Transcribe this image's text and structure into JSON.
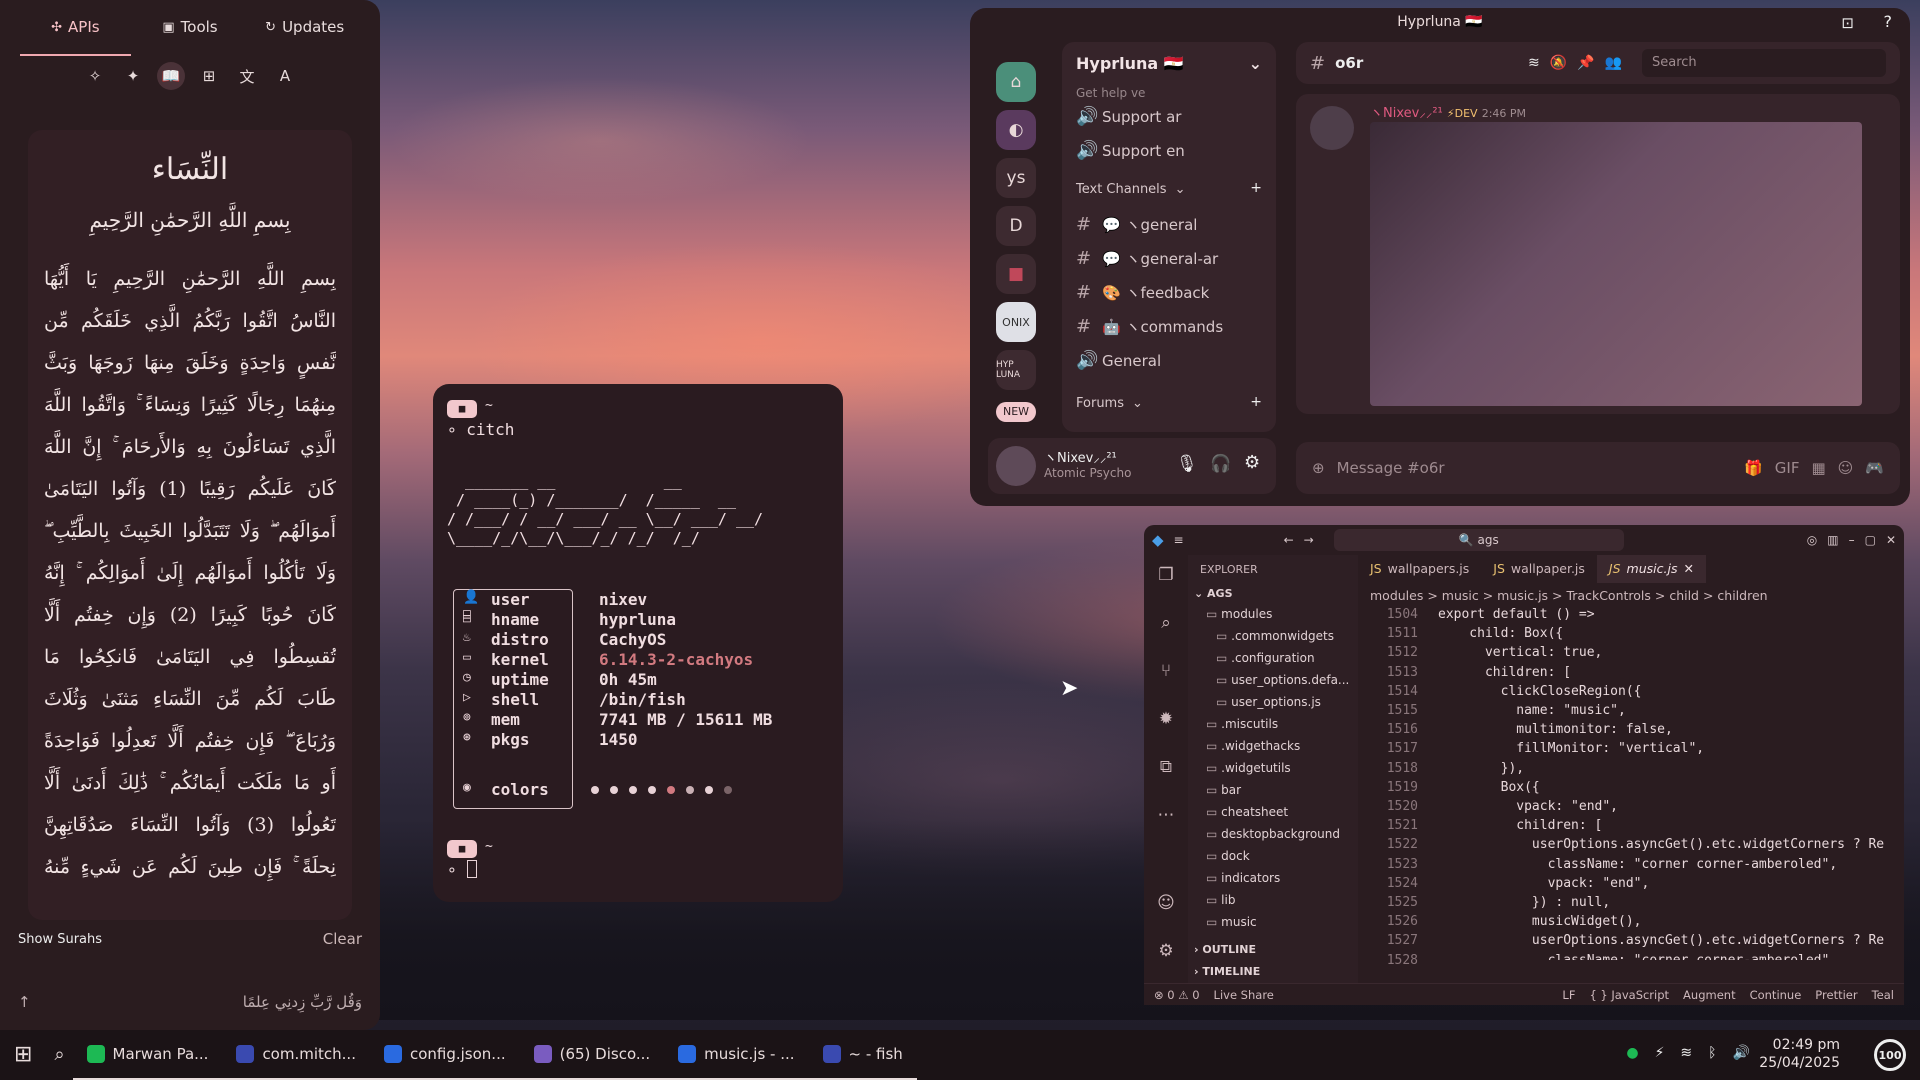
{
  "left_tabs": [
    "APIs",
    "Tools",
    "Updates"
  ],
  "quran": {
    "title": "النِّسَاء",
    "bismillah": "بِسمِ اللَّهِ الرَّحمَٰنِ الرَّحِيمِ",
    "lines": [
      "بِسمِ اللَّهِ الرَّحمَٰنِ الرَّحِيمِ يَا أَيُّهَا",
      "النَّاسُ اتَّقُوا رَبَّكُمُ الَّذِي خَلَقَكُم مِّن",
      "نَّفسٍ وَاحِدَةٍ وَخَلَقَ مِنهَا زَوجَهَا وَبَثَّ",
      "مِنهُمَا رِجَالًا كَثِيرًا وَنِسَاءً ۚ وَاتَّقُوا اللَّهَ",
      "الَّذِي تَسَاءَلُونَ بِهِ وَالأَرحَامَ ۚ إِنَّ اللَّهَ",
      "كَانَ عَلَيكُم رَقِيبًا (1) وَآتُوا اليَتَامَىٰ",
      "أَموَالَهُم ۖ وَلَا تَتَبَدَّلُوا الخَبِيثَ بِالطَّيِّبِ ۖ",
      "وَلَا تَأكُلُوا أَموَالَهُم إِلَىٰ أَموَالِكُم ۚ إِنَّهُ",
      "كَانَ حُوبًا كَبِيرًا (2) وَإِن خِفتُم أَلَّا",
      "تُقسِطُوا فِي اليَتَامَىٰ فَانكِحُوا مَا",
      "طَابَ لَكُم مِّنَ النِّسَاءِ مَثنَىٰ وَثُلَاثَ",
      "وَرُبَاعَ ۖ فَإِن خِفتُم أَلَّا تَعدِلُوا فَوَاحِدَةً",
      "أَو مَا مَلَكَت أَيمَانُكُم ۚ ذَٰلِكَ أَدنَىٰ أَلَّا",
      "تَعُولُوا (3) وَآتُوا النِّسَاءَ صَدُقَاتِهِنَّ",
      "نِحلَةً ۚ فَإِن طِبنَ لَكُم عَن شَيءٍ مِّنهُ"
    ],
    "show_surahs": "Show Surahs",
    "clear": "Clear",
    "prompt": "وَقُل رَّبِّ زِدنِي عِلمًا"
  },
  "terminal": {
    "dir": "~",
    "cmd": "citch",
    "ascii": "  _______ __            __\n / ____(_) /_______/  /_____  __\n/ /___/ / __/ ___/ __ \\__/ ___/ __/\n\\____/_/\\__/\\___/_/ /_/  /_/",
    "rows": [
      {
        "k": "user",
        "v": "nixev"
      },
      {
        "k": "hname",
        "v": "hyprluna"
      },
      {
        "k": "distro",
        "v": "CachyOS"
      },
      {
        "k": "kernel",
        "v": "6.14.3-2-cachyos"
      },
      {
        "k": "uptime",
        "v": "0h 45m"
      },
      {
        "k": "shell",
        "v": "/bin/fish"
      },
      {
        "k": "mem",
        "v": "7741 MB / 15611 MB"
      },
      {
        "k": "pkgs",
        "v": "1450"
      }
    ],
    "colors_label": "colors"
  },
  "discord": {
    "title": "Hyprluna 🇪🇬",
    "server": "Hyprluna 🇪🇬",
    "channel_top": "Get help ve",
    "channels": [
      {
        "t": "voice",
        "n": "Support ar"
      },
      {
        "t": "voice",
        "n": "Support en"
      }
    ],
    "text_channels_label": "Text Channels",
    "text_channels": [
      "💬 ヽgeneral",
      "💬 ヽgeneral-ar",
      "🎨 ヽfeedback",
      "🤖 ヽcommands"
    ],
    "general_voice": "General",
    "forums": "Forums",
    "current_channel": "o6r",
    "search_ph": "Search",
    "msg_user": "ヽNixev⸝⸝²¹",
    "msg_tag": "⚡DEV",
    "msg_time": "2:46 PM",
    "input_ph": "Message #o6r",
    "me_name": "ヽNixev⸝⸝²¹",
    "me_status": "Atomic Psycho",
    "servers": [
      "ys",
      "D"
    ],
    "new_badge": "NEW"
  },
  "vscode": {
    "search": "ags",
    "explorer": "EXPLORER",
    "root": "AGS",
    "tree": [
      "modules",
      ".commonwidgets",
      ".configuration",
      "user_options.defa...",
      "user_options.js",
      ".miscutils",
      ".widgethacks",
      ".widgetutils",
      "bar",
      "cheatsheet",
      "desktopbackground",
      "dock",
      "indicators",
      "lib",
      "music"
    ],
    "outline": "OUTLINE",
    "timeline": "TIMELINE",
    "tabs": [
      "wallpapers.js",
      "wallpaper.js",
      "music.js"
    ],
    "crumb": "modules > music > music.js > TrackControls > child > children",
    "gutter": [
      "1504",
      "1511",
      "1512",
      "1513",
      "1514",
      "1515",
      "1516",
      "1517",
      "1518",
      "1519",
      "1520",
      "1521",
      "1522",
      "1523",
      "1524",
      "1525",
      "1526",
      "1527",
      "1528"
    ],
    "code": "export default () =>\n    child: Box({\n      vertical: true,\n      children: [\n        clickCloseRegion({\n          name: \"music\",\n          multimonitor: false,\n          fillMonitor: \"vertical\",\n        }),\n        Box({\n          vpack: \"end\",\n          children: [\n            userOptions.asyncGet().etc.widgetCorners ? Re\n              className: \"corner corner-amberoled\",\n              vpack: \"end\",\n            }) : null,\n            musicWidget(),\n            userOptions.asyncGet().etc.widgetCorners ? Re\n              className: \"corner corner-amberoled\",\n              vpack: \"end\",",
    "status": [
      "⊗ 0 ⚠ 0",
      "Live Share",
      "LF",
      "{ } JavaScript",
      "Augment",
      "Continue",
      "Prettier",
      "Teal"
    ]
  },
  "taskbar": {
    "items": [
      "Marwan Pa...",
      "com.mitch...",
      "config.json...",
      "(65) Disco...",
      "music.js - ...",
      "~ - fish"
    ],
    "time": "02:49 pm",
    "date": "25/04/2025",
    "battery": "100"
  },
  "colors": {
    "accent": "#f0a8b0",
    "dots": [
      "#e8d2d6",
      "#e8d2d6",
      "#e8d2d6",
      "#e8d2d6",
      "#d27a80",
      "#c9b0b4",
      "#e8d2d6",
      "#7b6468"
    ]
  }
}
